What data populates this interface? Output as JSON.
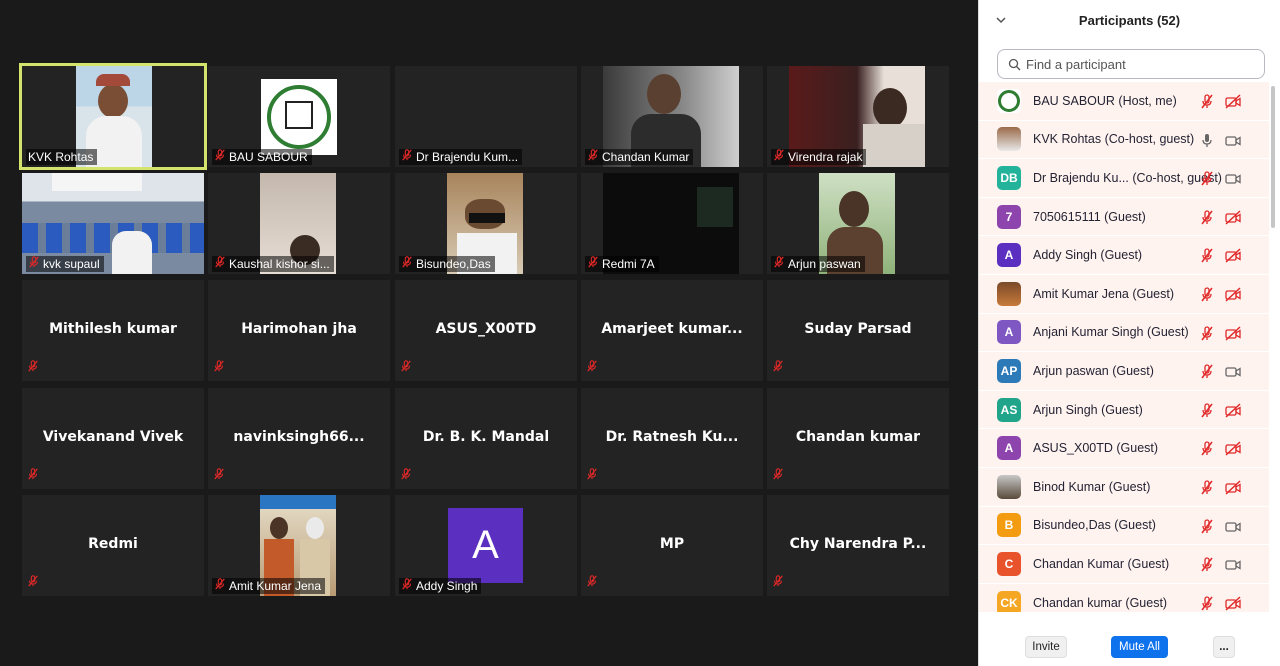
{
  "colors": {
    "active_border": "#d4e36c",
    "muted_red": "#e02828",
    "mute_all_blue": "#0e72ed",
    "tile_bg": "#232323"
  },
  "gallery": {
    "tiles": [
      {
        "name": "KVK Rohtas",
        "type": "video",
        "active": true,
        "muted": false
      },
      {
        "name": "BAU SABOUR",
        "type": "video",
        "muted": true
      },
      {
        "name": "Dr Brajendu Kum...",
        "type": "video",
        "muted": true
      },
      {
        "name": "Chandan Kumar",
        "type": "video",
        "muted": true
      },
      {
        "name": "Virendra rajak",
        "type": "video",
        "muted": true
      },
      {
        "name": "kvk supaul",
        "type": "video",
        "muted": true
      },
      {
        "name": "Kaushal kishor si...",
        "type": "video",
        "muted": true
      },
      {
        "name": "Bisundeo,Das",
        "type": "video",
        "muted": true
      },
      {
        "name": "Redmi 7A",
        "type": "video",
        "muted": true
      },
      {
        "name": "Arjun paswan",
        "type": "video",
        "muted": true
      },
      {
        "name": "Mithilesh kumar",
        "type": "name",
        "muted": true
      },
      {
        "name": "Harimohan jha",
        "type": "name",
        "muted": true
      },
      {
        "name": "ASUS_X00TD",
        "type": "name",
        "muted": true
      },
      {
        "name": "Amarjeet  kumar...",
        "type": "name",
        "muted": true
      },
      {
        "name": "Suday Parsad",
        "type": "name",
        "muted": true
      },
      {
        "name": "Vivekanand Vivek",
        "type": "name",
        "muted": true
      },
      {
        "name": "navinksingh66...",
        "type": "name",
        "muted": true
      },
      {
        "name": "Dr. B. K. Mandal",
        "type": "name",
        "muted": true
      },
      {
        "name": "Dr. Ratnesh Ku...",
        "type": "name",
        "muted": true
      },
      {
        "name": "Chandan kumar",
        "type": "name",
        "muted": true
      },
      {
        "name": "Redmi",
        "type": "name",
        "muted": true
      },
      {
        "name": "Amit Kumar Jena",
        "type": "video",
        "muted": true
      },
      {
        "name": "Addy Singh",
        "type": "letter",
        "letter": "A",
        "muted": true
      },
      {
        "name": "MP",
        "type": "name",
        "muted": true
      },
      {
        "name": "Chy Narendra P...",
        "type": "name",
        "muted": true
      }
    ]
  },
  "panel": {
    "title": "Participants (52)",
    "search_placeholder": "Find a participant",
    "participants": [
      {
        "name": "BAU SABOUR (Host, me)",
        "avatar": "logo",
        "mic": "muted",
        "video": "off"
      },
      {
        "name": "KVK Rohtas (Co-host, guest)",
        "avatar": "photo",
        "mic": "on",
        "video": "on"
      },
      {
        "name": "Dr Brajendu Ku... (Co-host, guest)",
        "avatar": "DB",
        "color": "#23b29a",
        "mic": "muted",
        "video": "on"
      },
      {
        "name": "7050615111 (Guest)",
        "avatar": "7",
        "color": "#8e44ad",
        "mic": "muted",
        "video": "off"
      },
      {
        "name": "Addy Singh (Guest)",
        "avatar": "A",
        "color": "#5b2fbf",
        "mic": "muted",
        "video": "off"
      },
      {
        "name": "Amit Kumar Jena (Guest)",
        "avatar": "photo",
        "mic": "muted",
        "video": "off"
      },
      {
        "name": "Anjani Kumar Singh (Guest)",
        "avatar": "A",
        "color": "#7e57c2",
        "mic": "muted",
        "video": "off"
      },
      {
        "name": "Arjun paswan (Guest)",
        "avatar": "AP",
        "color": "#2d7ab8",
        "mic": "muted",
        "video": "on"
      },
      {
        "name": "Arjun Singh (Guest)",
        "avatar": "AS",
        "color": "#20a58a",
        "mic": "muted",
        "video": "off"
      },
      {
        "name": "ASUS_X00TD (Guest)",
        "avatar": "A",
        "color": "#8e44ad",
        "mic": "muted",
        "video": "off"
      },
      {
        "name": "Binod Kumar (Guest)",
        "avatar": "photo",
        "mic": "muted",
        "video": "off"
      },
      {
        "name": "Bisundeo,Das (Guest)",
        "avatar": "B",
        "color": "#f39c12",
        "mic": "muted",
        "video": "on"
      },
      {
        "name": "Chandan Kumar (Guest)",
        "avatar": "C",
        "color": "#e8532b",
        "mic": "muted",
        "video": "on"
      },
      {
        "name": "Chandan kumar (Guest)",
        "avatar": "CK",
        "color": "#f5a623",
        "mic": "muted",
        "video": "off"
      }
    ],
    "footer": {
      "invite": "Invite",
      "mute_all": "Mute All",
      "more": "..."
    }
  }
}
